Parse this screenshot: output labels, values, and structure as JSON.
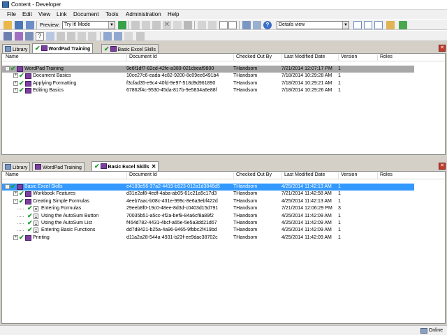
{
  "window": {
    "title": "Content - Developer"
  },
  "menu": [
    "File",
    "Edit",
    "View",
    "Link",
    "Document",
    "Tools",
    "Administration",
    "Help"
  ],
  "toolbar": {
    "preview_label": "Preview:",
    "preview_mode": "Try It! Mode",
    "view_mode": "Details view"
  },
  "colors": {
    "selection_blue": "#3399ff",
    "selection_gray": "#a8a8a8",
    "check_green": "#1d9a2d",
    "book_purple": "#7b3fa0"
  },
  "top_panel": {
    "tabs": [
      {
        "label": "Library",
        "icon": "library-icon"
      },
      {
        "label": "WordPad Training",
        "icon": "book-icon",
        "active": true
      },
      {
        "label": "Basic Excel Skills",
        "icon": "book-icon"
      }
    ],
    "columns": [
      "Name",
      "Document Id",
      "Checked Out By",
      "Last Modified Date",
      "Version",
      "Roles"
    ],
    "rows": [
      {
        "name": "WordPad Training",
        "id": "9e6f1df7-82cd-42fe-a389-021cbeaf9800",
        "by": "THandsom",
        "date": "7/21/2014 12:07:17 PM",
        "version": "1",
        "icon": "book",
        "level": 0,
        "expander": "-"
      },
      {
        "name": "Document Basics",
        "id": "10ce27c6-eada-4c82-9200-8c09ee6491b4",
        "by": "THandsom",
        "date": "7/18/2014 10:29:28 AM",
        "version": "1",
        "icon": "book",
        "level": 1,
        "expander": "+"
      },
      {
        "name": "Applying Formatting",
        "id": "f3cfad35-e9c4-40fd-9e97-518d9d961890",
        "by": "THandsom",
        "date": "7/18/2014 10:29:21 AM",
        "version": "1",
        "icon": "book",
        "level": 1,
        "expander": "+"
      },
      {
        "name": "Editing Basics",
        "id": "67862f4c-9530-45da-817b-9e5834a6e88f",
        "by": "THandsom",
        "date": "7/18/2014 10:29:26 AM",
        "version": "1",
        "icon": "book",
        "level": 1,
        "expander": "+"
      }
    ]
  },
  "bottom_panel": {
    "tabs": [
      {
        "label": "Library",
        "icon": "library-icon"
      },
      {
        "label": "WordPad Training",
        "icon": "book-icon"
      },
      {
        "label": "Basic Excel Skills",
        "icon": "book-icon",
        "active": true
      }
    ],
    "columns": [
      "Name",
      "Document Id",
      "Checked Out By",
      "Last Modified Date",
      "Version",
      "Roles"
    ],
    "rows": [
      {
        "name": "Basic Excel Skills",
        "id": "e4189e56-37a2-4419-b923-012a1d3846d5",
        "by": "THandsom",
        "date": "4/25/2014 11:42:13 AM",
        "version": "1",
        "icon": "book",
        "level": 0,
        "expander": "-"
      },
      {
        "name": "Workbook Features",
        "id": "d31e2af8-4edf-4aba-ab05-61c21a5c17d3",
        "by": "THandsom",
        "date": "7/21/2014 11:42:58 AM",
        "version": "1",
        "icon": "book",
        "level": 1,
        "expander": "+"
      },
      {
        "name": "Creating Simple Formulas",
        "id": "4eeb7aac-b08c-431e-999c-8e6a3ebf422d",
        "by": "THandsom",
        "date": "4/25/2014 11:42:13 AM",
        "version": "1",
        "icon": "book",
        "level": 1,
        "expander": "-"
      },
      {
        "name": "Entering Formulas",
        "id": "29eeb8f0-19c0-48ee-8d3d-c0403d15d791",
        "by": "THandsom",
        "date": "7/21/2014 12:06:29 PM",
        "version": "3",
        "icon": "page",
        "level": 2,
        "expander": ""
      },
      {
        "name": "Using the AutoSum Button",
        "id": "70035b51-a5cc-4f2a-bef9-84a6cf8a89f2",
        "by": "THandsom",
        "date": "4/25/2014 11:42:09 AM",
        "version": "1",
        "icon": "page",
        "level": 2,
        "expander": ""
      },
      {
        "name": "Using the AutoSum List",
        "id": "f464d782-4431-4bcf-a65e-5e5a3dd21d67",
        "by": "THandsom",
        "date": "4/25/2014 11:42:09 AM",
        "version": "1",
        "icon": "page",
        "level": 2,
        "expander": ""
      },
      {
        "name": "Entering Basic Functions",
        "id": "dd7d8421-b25a-4a96-9465-9fbbc2f419bd",
        "by": "THandsom",
        "date": "4/25/2014 11:42:09 AM",
        "version": "1",
        "icon": "page",
        "level": 2,
        "expander": ""
      },
      {
        "name": "Printing",
        "id": "d11a2a28-544a-4931-b23f-ee9dac38702c",
        "by": "THandsom",
        "date": "4/25/2014 11:42:09 AM",
        "version": "1",
        "icon": "book",
        "level": 1,
        "expander": "+"
      }
    ]
  },
  "status": {
    "connection": "Online"
  }
}
